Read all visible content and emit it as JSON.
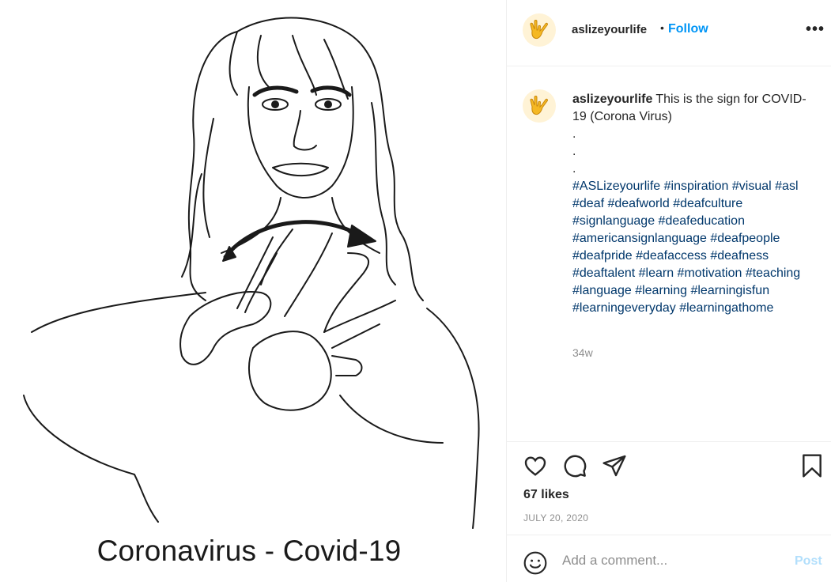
{
  "post": {
    "username": "aslizeyourlife",
    "follow_label": "Follow",
    "separator": "•",
    "more_label": "•••",
    "media": {
      "caption_text": "Coronavirus - Covid-19",
      "avatar_icon": "ily-hand-emoji-icon"
    },
    "caption": {
      "username": "aslizeyourlife",
      "text": "This is the sign for COVID-19 (Corona Virus)",
      "dots": [
        ".",
        ".",
        "."
      ],
      "hashtags": "#ASLizeyourlife #inspiration #visual #asl #deaf #deafworld #deafculture #signlanguage #deafeducation #americansignlanguage #deafpeople #deafpride #deafaccess #deafness #deaftalent #learn #motivation #teaching #language #learning #learningisfun #learningeveryday #learningathome"
    },
    "time_ago": "34w",
    "likes": "67 likes",
    "date": "JULY 20, 2020",
    "comment_placeholder": "Add a comment...",
    "post_label": "Post",
    "colors": {
      "link": "#0095f6",
      "hashtag": "#00376b",
      "muted": "#8e8e8e",
      "post_disabled": "#b2dffc"
    }
  }
}
